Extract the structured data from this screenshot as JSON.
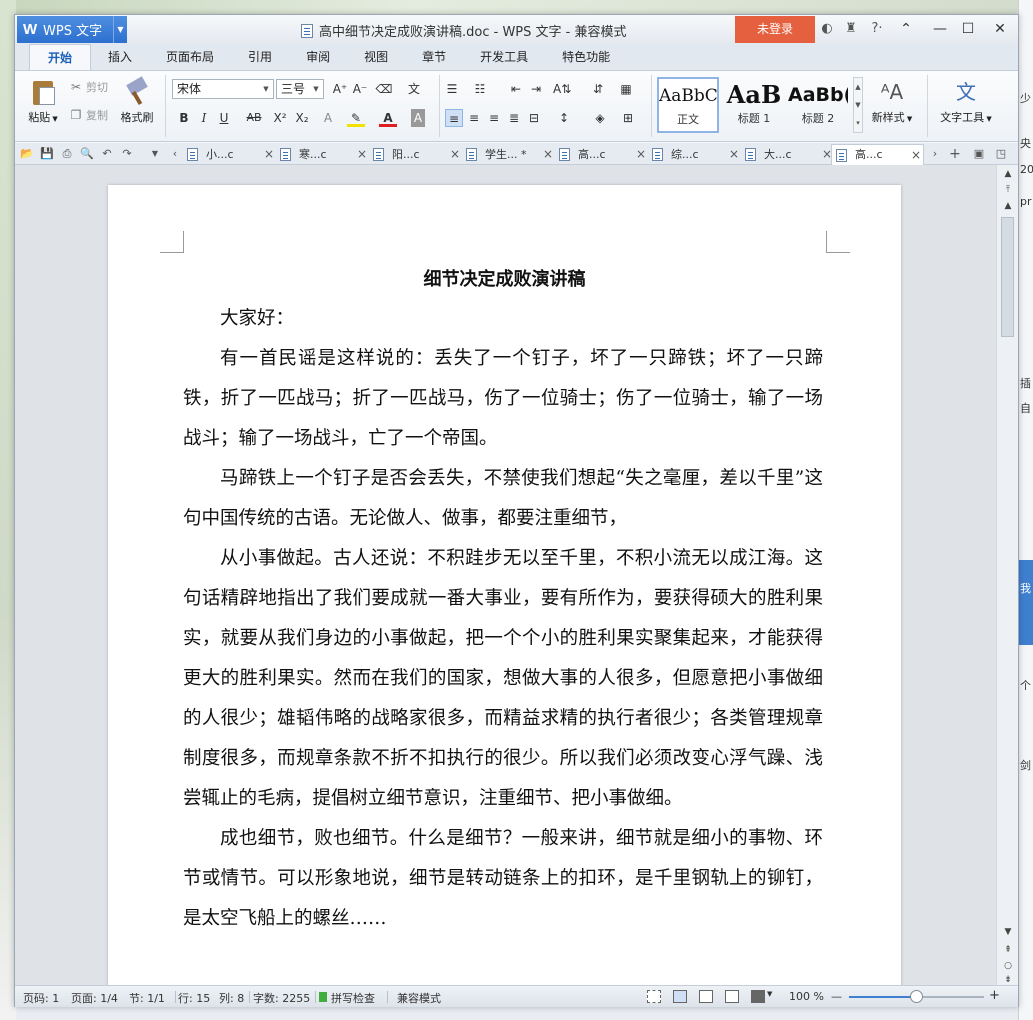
{
  "titlebar": {
    "app_menu": "WPS 文字",
    "doc_title": "高中细节决定成败演讲稿.doc - WPS 文字 - 兼容模式",
    "login": "未登录"
  },
  "tabs": [
    "开始",
    "插入",
    "页面布局",
    "引用",
    "审阅",
    "视图",
    "章节",
    "开发工具",
    "特色功能"
  ],
  "ribbon": {
    "paste": "粘贴",
    "cut": "剪切",
    "copy": "复制",
    "format_painter": "格式刷",
    "font_name": "宋体",
    "font_size": "三号",
    "styles": [
      {
        "sample": "AaBbC",
        "name": "正文"
      },
      {
        "sample": "AaB",
        "name": "标题 1"
      },
      {
        "sample": "AaBb(",
        "name": "标题 2"
      }
    ],
    "new_style": "新样式",
    "text_tools": "文字工具"
  },
  "doc_tabs": [
    "小...c",
    "寒...c",
    "阳...c",
    "学生... *",
    "高...c",
    "综...c",
    "大...c",
    "高...c"
  ],
  "document": {
    "heading": "细节决定成败演讲稿",
    "greeting": "大家好：",
    "paragraphs": [
      "有一首民谣是这样说的：丢失了一个钉子，坏了一只蹄铁；坏了一只蹄铁，折了一匹战马；折了一匹战马，伤了一位骑士；伤了一位骑士，输了一场战斗；输了一场战斗，亡了一个帝国。",
      "马蹄铁上一个钉子是否会丢失，不禁使我们想起“失之毫厘，差以千里”这句中国传统的古语。无论做人、做事，都要注重细节，",
      "从小事做起。古人还说：不积跬步无以至千里，不积小流无以成江海。这句话精辟地指出了我们要成就一番大事业，要有所作为，要获得硕大的胜利果实，就要从我们身边的小事做起，把一个个小的胜利果实聚集起来，才能获得更大的胜利果实。然而在我们的国家，想做大事的人很多，但愿意把小事做细的人很少；雄韬伟略的战略家很多，而精益求精的执行者很少；各类管理规章制度很多，而规章条款不折不扣执行的很少。所以我们必须改变心浮气躁、浅尝辄止的毛病，提倡树立细节意识，注重细节、把小事做细。",
      "成也细节，败也细节。什么是细节？一般来讲，细节就是细小的事物、环节或情节。可以形象地说，细节是转动链条上的扣环，是千里钢轨上的铆钉，是太空飞船上的螺丝……"
    ]
  },
  "status": {
    "page": "页码: 1",
    "pages": "页面: 1/4",
    "section": "节: 1/1",
    "line": "行: 15",
    "col": "列: 8",
    "words": "字数: 2255",
    "spell": "拼写检查",
    "mode": "兼容模式",
    "zoom": "100 %",
    "zoom_fraction": 0.5
  },
  "side_fragments": [
    "少",
    "央",
    "20",
    "pr",
    "插",
    "自",
    "我",
    "个",
    "剑"
  ]
}
